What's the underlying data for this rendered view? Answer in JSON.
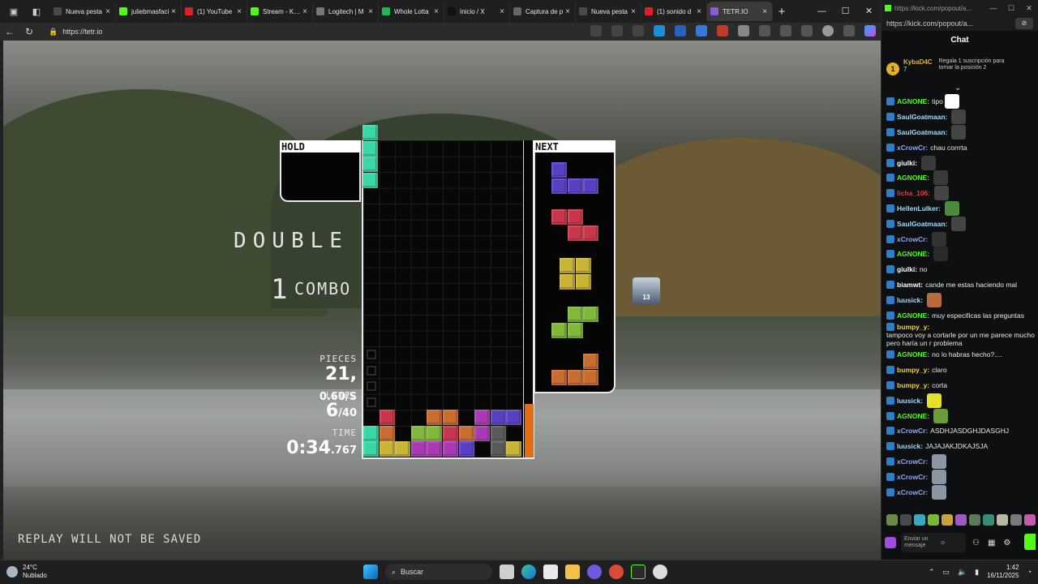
{
  "browser": {
    "tabs": [
      {
        "label": "Nueva pesta",
        "color": "#4a4a4a"
      },
      {
        "label": "juliebmasfaci",
        "color": "#53fc18"
      },
      {
        "label": "(1) YouTube",
        "color": "#e02020"
      },
      {
        "label": "Stream - Kick",
        "color": "#53fc18"
      },
      {
        "label": "Logitech | M",
        "color": "#777777"
      },
      {
        "label": "Whole Lotta",
        "color": "#1db954"
      },
      {
        "label": "Inicio / X",
        "color": "#111111"
      },
      {
        "label": "Captura de p",
        "color": "#666666"
      },
      {
        "label": "Nueva pesta",
        "color": "#4a4a4a"
      },
      {
        "label": "(1) sonido d",
        "color": "#e02020"
      },
      {
        "label": "TETR.IO",
        "color": "#8a5cd6",
        "active": true
      }
    ],
    "url": "https://tetr.io"
  },
  "game": {
    "hold_label": "HOLD",
    "next_label": "NEXT",
    "clear_text": "DOUBLE",
    "combo_number": "1",
    "combo_label": "COMBO",
    "pieces_label": "PIECES",
    "pieces_count": "21,",
    "pieces_rate": "0.60/S",
    "lines_label": "LINES",
    "lines_value": "6",
    "lines_goal": "/40",
    "time_label": "TIME",
    "time_main": "0:34",
    "time_ms": ".767",
    "replay_notice": "REPLAY WILL NOT BE SAVED",
    "avatar_level": "13",
    "garbage_meter": 0.17
  },
  "popout": {
    "url": "https://kick.com/popout/a...",
    "chat_title": "Chat",
    "pinned": {
      "rank": "1",
      "user": "KybaD4C",
      "count": "7",
      "text": "Regala 1 suscripción para tomar la posición 2"
    },
    "messages": [
      {
        "user": "AGNONE",
        "text": "tipo",
        "color": "#53fc18",
        "emote": "#ffffff"
      },
      {
        "user": "SaulGoatmaan",
        "text": "",
        "color": "#9fdcff",
        "emote": "#444444"
      },
      {
        "user": "SaulGoatmaan",
        "text": "",
        "color": "#9fdcff",
        "emote": "#444444"
      },
      {
        "user": "xCrowCr",
        "text": "chau corrrta",
        "color": "#8fa8ff"
      },
      {
        "user": "giulki",
        "text": "",
        "color": "#ffffff",
        "emote": "#3a3a3a"
      },
      {
        "user": "AGNONE",
        "text": "",
        "color": "#53fc18",
        "emote": "#3a3a3a"
      },
      {
        "user": "licha_106",
        "text": "",
        "color": "#e03c3c",
        "emote": "#444444"
      },
      {
        "user": "HellenLulker",
        "text": "",
        "color": "#9fdcff",
        "emote": "#4b8b3b"
      },
      {
        "user": "SaulGoatmaan",
        "text": "",
        "color": "#9fdcff",
        "emote": "#444444"
      },
      {
        "user": "xCrowCr",
        "text": "",
        "color": "#8fa8ff",
        "emote": "#333333"
      },
      {
        "user": "AGNONE",
        "text": "",
        "color": "#53fc18",
        "emote": "#2a2a2a"
      },
      {
        "user": "giulki",
        "text": "no",
        "color": "#ffffff"
      },
      {
        "user": "biamwt",
        "text": "cande me estas haciendo mal",
        "color": "#ffffff"
      },
      {
        "user": "luusick",
        "text": "",
        "color": "#9fdcff",
        "emote": "#b86b3c"
      },
      {
        "user": "AGNONE",
        "text": "muy especificas las preguntas",
        "color": "#53fc18"
      },
      {
        "user": "bumpy_y",
        "text": "tampoco voy a cortarle por un me parece mucho pero haría un r problema",
        "color": "#f0d040"
      },
      {
        "user": "AGNONE",
        "text": "no lo habras hecho?....",
        "color": "#53fc18"
      },
      {
        "user": "bumpy_y",
        "text": "claro",
        "color": "#f0d040"
      },
      {
        "user": "bumpy_y",
        "text": "corta",
        "color": "#f0d040"
      },
      {
        "user": "luusick",
        "text": "",
        "color": "#9fdcff",
        "emote": "#e4e02c"
      },
      {
        "user": "AGNONE",
        "text": "",
        "color": "#53fc18",
        "emote": "#6a9a3a"
      },
      {
        "user": "xCrowCr",
        "text": "ASDHJASDGHJDASGHJ",
        "color": "#8fa8ff"
      },
      {
        "user": "luusick",
        "text": "JAJAJAKJDKAJSJA",
        "color": "#9fdcff"
      },
      {
        "user": "xCrowCr",
        "text": "",
        "color": "#8fa8ff",
        "emote": "#8a97a3"
      },
      {
        "user": "xCrowCr",
        "text": "",
        "color": "#8fa8ff",
        "emote": "#8a97a3"
      },
      {
        "user": "xCrowCr",
        "text": "",
        "color": "#8fa8ff",
        "emote": "#8a97a3"
      }
    ],
    "input_placeholder": "Enviar un mensaje"
  },
  "taskbar": {
    "weather_temp": "24°C",
    "weather_desc": "Nublado",
    "search_label": "Buscar",
    "time": "1:42",
    "date": "16/11/2025"
  }
}
